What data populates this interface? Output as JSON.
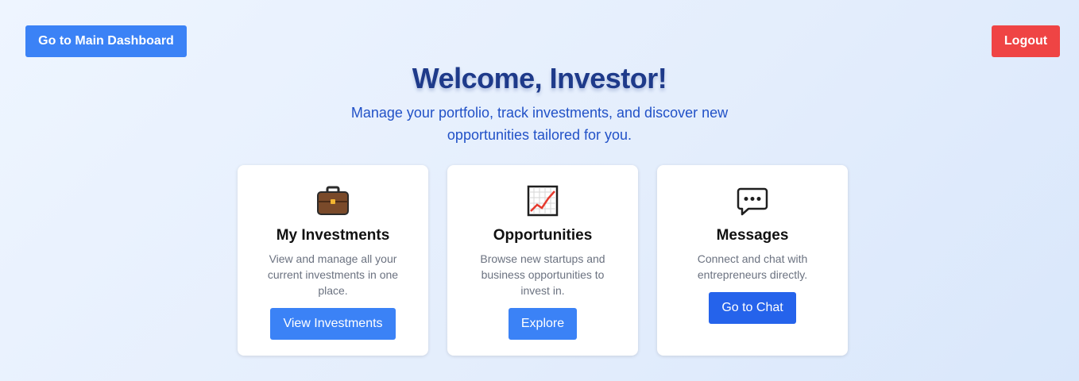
{
  "header": {
    "dashboard_label": "Go to Main Dashboard",
    "logout_label": "Logout",
    "title": "Welcome, Investor!",
    "subtitle": "Manage your portfolio, track investments, and discover new opportunities tailored for you."
  },
  "cards": [
    {
      "icon": "briefcase-icon",
      "title": "My Investments",
      "description": "View and manage all your current investments in one place.",
      "button": "View Investments"
    },
    {
      "icon": "chart-increasing-icon",
      "title": "Opportunities",
      "description": "Browse new startups and business opportunities to invest in.",
      "button": "Explore"
    },
    {
      "icon": "speech-bubble-icon",
      "title": "Messages",
      "description": "Connect and chat with entrepreneurs directly.",
      "button": "Go to Chat"
    }
  ],
  "colors": {
    "primary": "#3b82f6",
    "primary_dark": "#2563eb",
    "danger": "#ef4444",
    "title": "#1e3a8a"
  }
}
